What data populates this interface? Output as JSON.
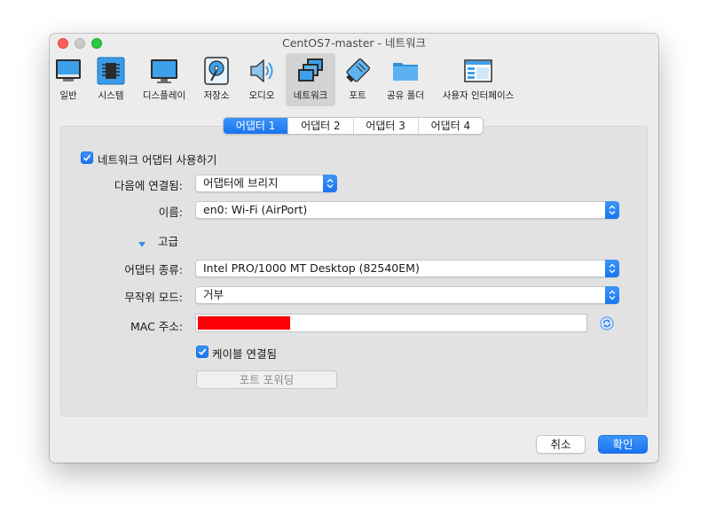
{
  "window": {
    "title": "CentOS7-master - 네트워크"
  },
  "toolbar": {
    "items": [
      {
        "label": "일반",
        "icon": "general-icon"
      },
      {
        "label": "시스템",
        "icon": "system-chip-icon"
      },
      {
        "label": "디스플레이",
        "icon": "display-monitor-icon"
      },
      {
        "label": "저장소",
        "icon": "storage-disk-icon"
      },
      {
        "label": "오디오",
        "icon": "audio-speaker-icon"
      },
      {
        "label": "네트워크",
        "icon": "network-icon",
        "selected": true
      },
      {
        "label": "포트",
        "icon": "serial-port-icon"
      },
      {
        "label": "공유 폴더",
        "icon": "shared-folder-icon"
      },
      {
        "label": "사용자 인터페이스",
        "icon": "user-interface-icon"
      }
    ]
  },
  "tabs": [
    {
      "label": "어댑터 1",
      "active": true
    },
    {
      "label": "어댑터 2"
    },
    {
      "label": "어댑터 3"
    },
    {
      "label": "어댑터 4"
    }
  ],
  "form": {
    "enable_adapter": {
      "label": "네트워크 어댑터 사용하기",
      "checked": true
    },
    "attached_to": {
      "label": "다음에 연결됨:",
      "value": "어댑터에 브리지"
    },
    "name": {
      "label": "이름:",
      "value": "en0: Wi-Fi (AirPort)"
    },
    "advanced": {
      "label": "고급",
      "expanded": true
    },
    "adapter_type": {
      "label": "어댑터 종류:",
      "value": "Intel PRO/1000 MT Desktop (82540EM)"
    },
    "promiscuous": {
      "label": "무작위 모드:",
      "value": "거부"
    },
    "mac": {
      "label": "MAC 주소:",
      "value": ""
    },
    "cable": {
      "label": "케이블 연결됨",
      "checked": true
    },
    "port_forwarding": {
      "label": "포트 포워딩"
    }
  },
  "footer": {
    "cancel": "취소",
    "ok": "확인"
  },
  "colors": {
    "accent": "#1b74f0",
    "redaction": "#fb0007"
  }
}
